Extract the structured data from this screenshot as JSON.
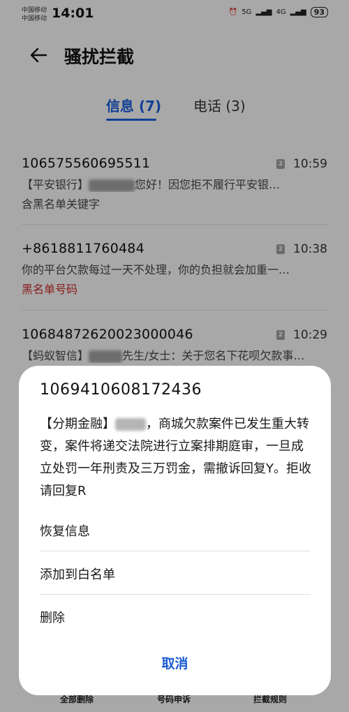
{
  "status_bar": {
    "carrier_1": "中国移动",
    "carrier_2": "中国移动",
    "time": "14:01",
    "signal_1": "5G",
    "signal_2": "4G",
    "battery": "93"
  },
  "header": {
    "title": "骚扰拦截"
  },
  "tabs": [
    {
      "label": "信息 (7)",
      "active": true
    },
    {
      "label": "电话 (3)",
      "active": false
    }
  ],
  "messages": [
    {
      "number": "106575560695511",
      "time": "10:59",
      "sim": "2",
      "preview_prefix": "【平安银行】",
      "preview_suffix": "您好！因您拒不履行平安银…",
      "note": "含黑名单关键字"
    },
    {
      "number": "+8618811760484",
      "time": "10:38",
      "sim": "2",
      "preview": "你的平台欠款每过一天不处理，你的负担就会加重一…",
      "note": "黑名单号码"
    },
    {
      "number": "1068487262002300004​6",
      "time": "10:29",
      "sim": "2",
      "preview_prefix": "【蚂蚁智信】",
      "preview_suffix": "先生/女士：关于您名下花呗欠款事…"
    }
  ],
  "sheet": {
    "number": "1069410608172436",
    "body_prefix": "【分期金融】",
    "body_suffix": "，商城欠款案件已发生重大转变，案件将递交法院进行立案排期庭审，一旦成立处罚一年刑责及三万罚金，需撤诉回复Y。拒收请回复R",
    "actions": [
      "恢复信息",
      "添加到白名单",
      "删除"
    ],
    "cancel": "取消"
  },
  "bottom_bar": [
    "全部删除",
    "号码申诉",
    "拦截规则"
  ]
}
